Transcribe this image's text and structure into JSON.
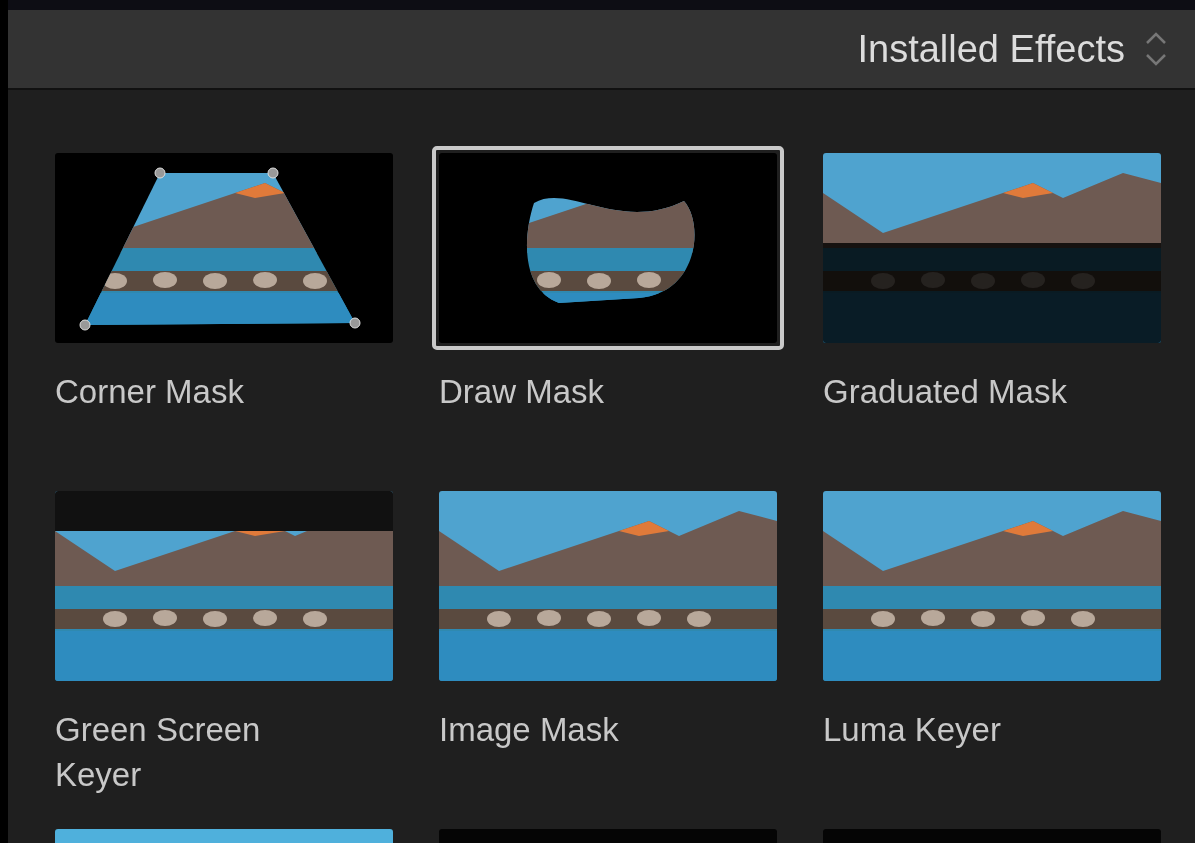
{
  "header": {
    "title": "Installed Effects"
  },
  "effects": [
    {
      "label": "Corner Mask",
      "selected": false,
      "kind": "corner"
    },
    {
      "label": "Draw Mask",
      "selected": true,
      "kind": "blob"
    },
    {
      "label": "Graduated Mask",
      "selected": false,
      "kind": "dark"
    },
    {
      "label": "Green Screen Keyer",
      "selected": false,
      "kind": "keyed"
    },
    {
      "label": "Image Mask",
      "selected": false,
      "kind": "full"
    },
    {
      "label": "Luma Keyer",
      "selected": false,
      "kind": "full"
    },
    {
      "selected": false,
      "kind": "sky"
    },
    {
      "selected": false,
      "kind": "black"
    },
    {
      "selected": false,
      "kind": "black"
    }
  ]
}
